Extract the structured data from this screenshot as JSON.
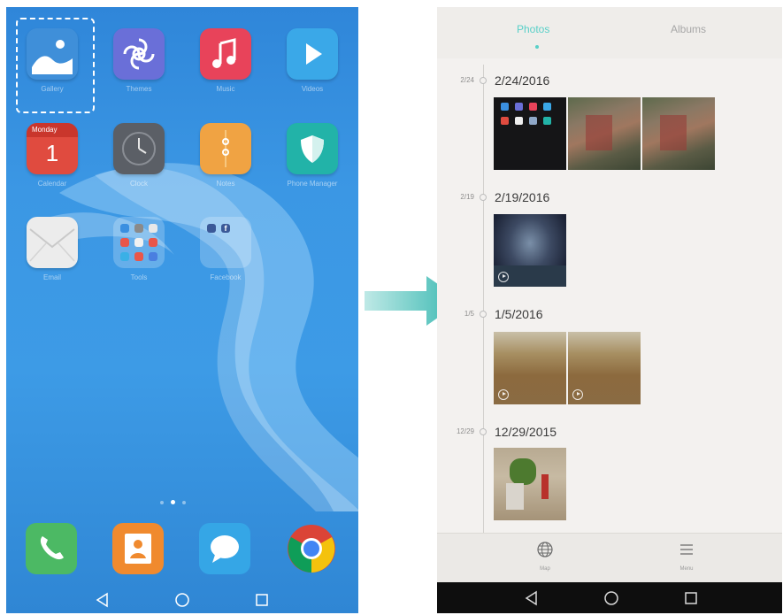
{
  "home": {
    "apps": [
      {
        "label": "Gallery",
        "icon": "gallery-icon",
        "color": "#3f8fd9"
      },
      {
        "label": "Themes",
        "icon": "themes-icon",
        "color": "#6a6fd8"
      },
      {
        "label": "Music",
        "icon": "music-icon",
        "color": "#e8435a"
      },
      {
        "label": "Videos",
        "icon": "videos-icon",
        "color": "#3aa8e8"
      },
      {
        "label": "Calendar",
        "icon": "calendar-icon",
        "color": "#d9423a"
      },
      {
        "label": "Clock",
        "icon": "clock-icon",
        "color": "#5b5f66"
      },
      {
        "label": "Notes",
        "icon": "notes-icon",
        "color": "#f0a343"
      },
      {
        "label": "Phone Manager",
        "icon": "phone-manager-icon",
        "color": "#22b3a8"
      },
      {
        "label": "Email",
        "icon": "email-icon",
        "color": "#e9e9e9"
      },
      {
        "label": "Tools",
        "icon": "tools-folder-icon",
        "color": "#8fb5d8"
      },
      {
        "label": "Facebook",
        "icon": "facebook-folder-icon",
        "color": "#8fb5d8"
      }
    ],
    "calendar": {
      "day_name": "Monday",
      "day_number": "1"
    },
    "dock": [
      {
        "icon": "phone-icon",
        "color": "#4cb964"
      },
      {
        "icon": "contacts-icon",
        "color": "#f08a2e"
      },
      {
        "icon": "messaging-icon",
        "color": "#35a6e6"
      },
      {
        "icon": "chrome-icon",
        "color": "#ffffff"
      }
    ],
    "pager": {
      "pages": 3,
      "current": 2
    },
    "navbar": [
      "back-icon",
      "home-icon",
      "recents-icon"
    ]
  },
  "gallery": {
    "tabs": [
      {
        "label": "Photos",
        "active": true
      },
      {
        "label": "Albums",
        "active": false
      }
    ],
    "accent_color": "#59d0c8",
    "sections": [
      {
        "short": "2/24",
        "date": "2/24/2016",
        "thumbs": [
          {
            "kind": "screenshot",
            "video": false
          },
          {
            "kind": "building",
            "video": false
          },
          {
            "kind": "building",
            "video": false
          }
        ]
      },
      {
        "short": "2/19",
        "date": "2/19/2016",
        "thumbs": [
          {
            "kind": "night-sky",
            "video": true
          }
        ]
      },
      {
        "short": "1/5",
        "date": "1/5/2016",
        "thumbs": [
          {
            "kind": "blur-sand",
            "video": true
          },
          {
            "kind": "blur-sand",
            "video": true
          }
        ]
      },
      {
        "short": "12/29",
        "date": "12/29/2015",
        "thumbs": [
          {
            "kind": "plant",
            "video": false
          }
        ]
      }
    ],
    "bottom": [
      {
        "label": "Map",
        "icon": "globe-icon"
      },
      {
        "label": "Menu",
        "icon": "menu-icon"
      }
    ],
    "navbar": [
      "back-icon",
      "home-icon",
      "recents-icon"
    ]
  }
}
